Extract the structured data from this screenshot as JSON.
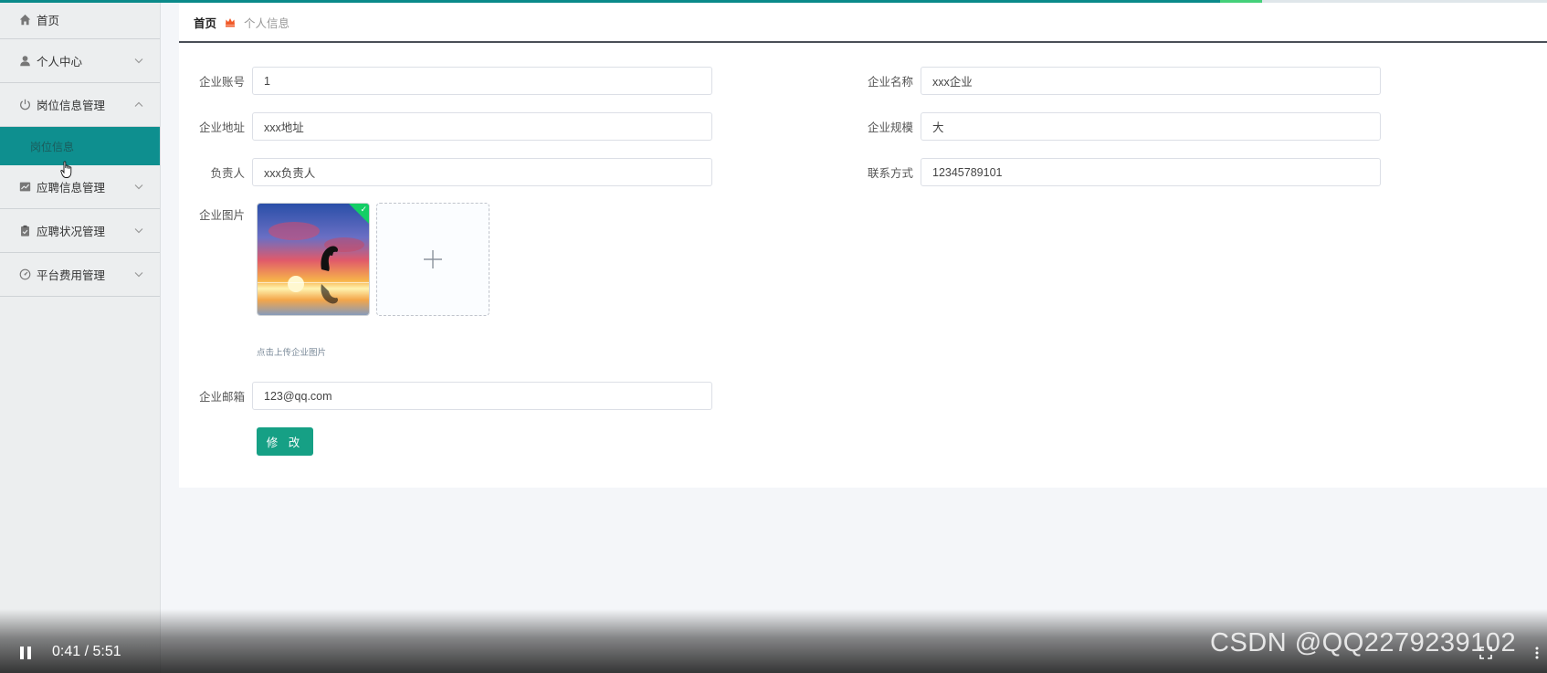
{
  "sidebar": {
    "items": [
      {
        "label": "首页",
        "icon": "home-icon"
      },
      {
        "label": "个人中心",
        "icon": "user-icon"
      },
      {
        "label": "岗位信息管理",
        "icon": "power-icon"
      },
      {
        "label": "应聘信息管理",
        "icon": "chart-icon"
      },
      {
        "label": "应聘状况管理",
        "icon": "clipboard-icon"
      },
      {
        "label": "平台费用管理",
        "icon": "dashboard-icon"
      }
    ],
    "active_sub_item": "岗位信息"
  },
  "breadcrumb": {
    "home": "首页",
    "current": "个人信息"
  },
  "form": {
    "account": {
      "label": "企业账号",
      "value": "1"
    },
    "company_name": {
      "label": "企业名称",
      "value": "xxx企业"
    },
    "address": {
      "label": "企业地址",
      "value": "xxx地址"
    },
    "scale": {
      "label": "企业规模",
      "value": "大"
    },
    "contact_person": {
      "label": "负责人",
      "value": "xxx负责人"
    },
    "phone": {
      "label": "联系方式",
      "value": "12345789101"
    },
    "image": {
      "label": "企业图片",
      "tip": "点击上传企业图片"
    },
    "email": {
      "label": "企业邮箱",
      "value": "123@qq.com"
    },
    "submit_label": "修 改"
  },
  "video": {
    "time": "0:41 / 5:51",
    "watermark": "CSDN @QQ2279239102"
  },
  "colors": {
    "accent": "#0e8f8f",
    "button": "#16a085",
    "upload_success": "#13ce66"
  }
}
